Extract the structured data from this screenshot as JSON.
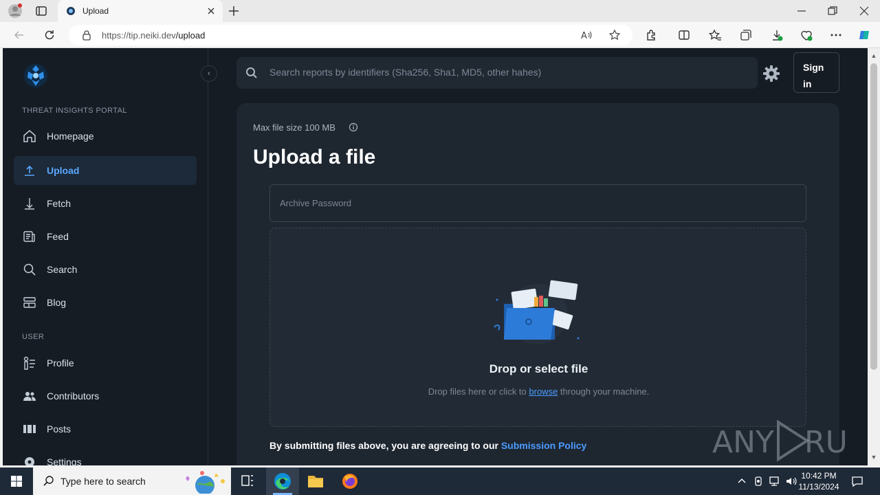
{
  "browser": {
    "tab_title": "Upload",
    "url_host": "https://tip.neiki.dev",
    "url_path": "/upload"
  },
  "sidebar": {
    "section_portal": "THREAT INSIGHTS PORTAL",
    "section_user": "USER",
    "items": [
      {
        "label": "Homepage",
        "icon": "home-icon"
      },
      {
        "label": "Upload",
        "icon": "upload-icon",
        "active": true
      },
      {
        "label": "Fetch",
        "icon": "fetch-icon"
      },
      {
        "label": "Feed",
        "icon": "feed-icon"
      },
      {
        "label": "Search",
        "icon": "search-icon"
      },
      {
        "label": "Blog",
        "icon": "blog-icon"
      },
      {
        "label": "Profile",
        "icon": "profile-icon"
      },
      {
        "label": "Contributors",
        "icon": "contributors-icon"
      },
      {
        "label": "Posts",
        "icon": "posts-icon"
      },
      {
        "label": "Settings",
        "icon": "settings-icon"
      }
    ]
  },
  "header": {
    "search_placeholder": "Search reports by identifiers (Sha256, Sha1, MD5, other hahes)",
    "signin_line1": "Sign",
    "signin_line2": "in"
  },
  "upload": {
    "max_size": "Max file size 100 MB",
    "title": "Upload a file",
    "password_placeholder": "Archive Password",
    "drop_title": "Drop or select file",
    "drop_sub_before": "Drop files here or click to ",
    "drop_sub_link": "browse",
    "drop_sub_after": " through your machine.",
    "policy_text": "By submitting files above, you are agreeing to our ",
    "policy_link": "Submission Policy"
  },
  "watermark": "ANY RUN",
  "taskbar": {
    "search_text": "Type here to search",
    "time": "10:42 PM",
    "date": "11/13/2024"
  },
  "colors": {
    "page_bg": "#161c24",
    "card_bg": "#1e2630",
    "accent": "#4c9cff",
    "active_nav_bg": "#1c2a3a"
  }
}
